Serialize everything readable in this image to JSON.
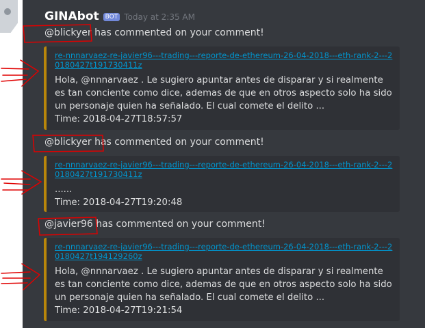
{
  "colors": {
    "background": "#36393e",
    "embed_border": "#b8860b",
    "link": "#0096cf",
    "bot_badge": "#7289da",
    "annotation": "#e00000"
  },
  "header": {
    "username": "GINAbot",
    "badge": "BOT",
    "timestamp": "Today at 2:35 AM"
  },
  "messages": [
    {
      "mention": "@blickyer",
      "text": " has commented on your comment!",
      "embed": {
        "link": "re-nnnarvaez-re-javier96---trading---reporte-de-ethereum-26-04-2018---eth-rank-2---20180427t191730411z",
        "body": "Hola, @nnnarvaez . Le sugiero apuntar antes de disparar y si realmente es tan conciente como dice, ademas de que en otros aspecto solo ha sido un personaje quien ha señalado. El cual comete el delito ...",
        "time": "Time: 2018-04-27T18:57:57"
      }
    },
    {
      "mention": "@blickyer",
      "text": " has commented on your comment!",
      "embed": {
        "link": "re-nnnarvaez-re-javier96---trading---reporte-de-ethereum-26-04-2018---eth-rank-2---20180427t191730411z",
        "body": "......",
        "time": "Time: 2018-04-27T19:20:48"
      }
    },
    {
      "mention": "@javier96",
      "text": " has commented on your comment!",
      "embed": {
        "link": "re-nnnarvaez-re-javier96---trading---reporte-de-ethereum-26-04-2018---eth-rank-2---20180427t194129260z",
        "body": "Hola, @nnnarvaez . Le sugiero apuntar antes de disparar y si realmente es tan conciente como dice, ademas de que en otros aspecto solo ha sido un personaje quien ha señalado. El cual comete el delito ...",
        "time": "Time: 2018-04-27T19:21:54"
      }
    }
  ]
}
